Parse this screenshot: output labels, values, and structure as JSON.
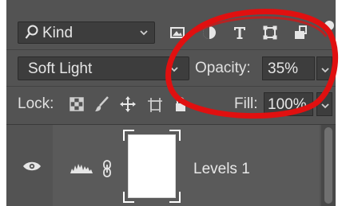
{
  "filter": {
    "kind_label": "Kind",
    "icons": [
      "image-filter-icon",
      "adjustment-filter-icon",
      "type-filter-icon",
      "shape-filter-icon",
      "smart-object-filter-icon"
    ]
  },
  "blend": {
    "mode": "Soft Light",
    "opacity_label": "Opacity:",
    "opacity_value": "35%"
  },
  "lock": {
    "label": "Lock:",
    "fill_label": "Fill:",
    "fill_value": "100%"
  },
  "layer": {
    "name": "Levels 1"
  },
  "colors": {
    "panel": "#535353",
    "field": "#3d3d3d",
    "annotation": "#e01010"
  }
}
